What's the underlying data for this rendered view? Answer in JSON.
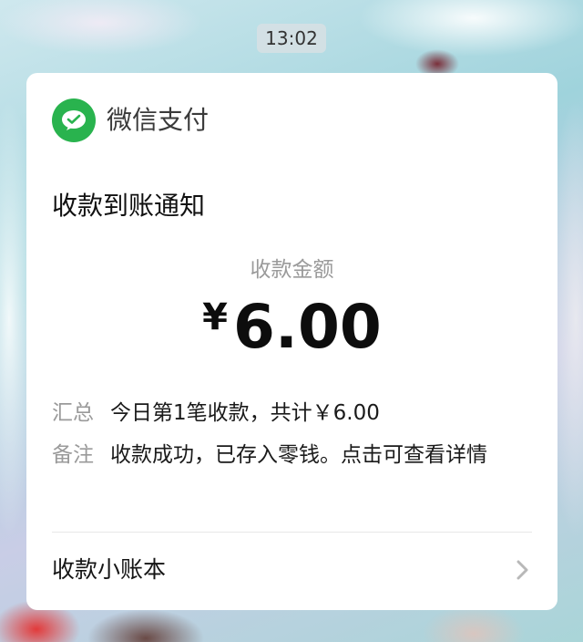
{
  "status_bar": {
    "time": "13:02"
  },
  "card": {
    "app_name": "微信支付",
    "app_icon": "wechat-pay-icon",
    "title": "收款到账通知",
    "amount_label": "收款金额",
    "amount_currency": "¥",
    "amount_value": "6.00",
    "details": [
      {
        "key": "汇总",
        "value": "今日第1笔收款，共计￥6.00"
      },
      {
        "key": "备注",
        "value": "收款成功，已存入零钱。点击可查看详情"
      }
    ],
    "footer_link": "收款小账本",
    "footer_icon": "chevron-right-icon"
  },
  "colors": {
    "brand_green": "#29b34e",
    "card_bg": "#ffffff",
    "muted_text": "#9a9a9a"
  }
}
